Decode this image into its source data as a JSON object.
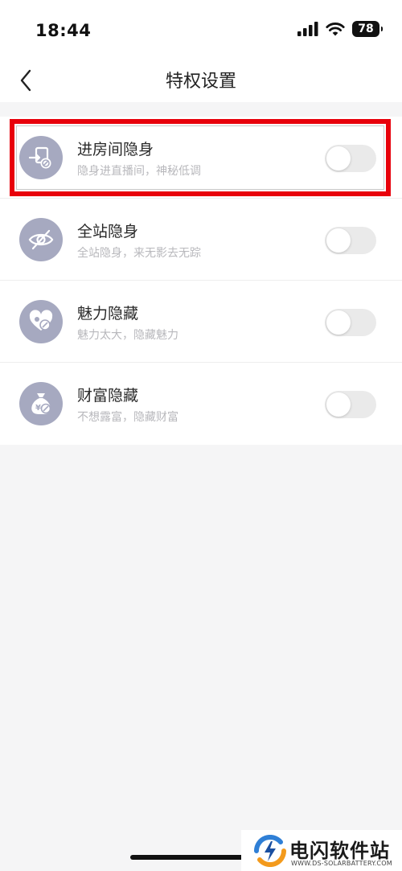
{
  "status_bar": {
    "time": "18:44",
    "battery": "78"
  },
  "header": {
    "title": "特权设置"
  },
  "settings": [
    {
      "title": "进房间隐身",
      "subtitle": "隐身进直播间，神秘低调",
      "icon": "enter-room-hidden-icon",
      "enabled": false
    },
    {
      "title": "全站隐身",
      "subtitle": "全站隐身，来无影去无踪",
      "icon": "eye-hidden-icon",
      "enabled": false
    },
    {
      "title": "魅力隐藏",
      "subtitle": "魅力太大，隐藏魅力",
      "icon": "heart-hidden-icon",
      "enabled": false
    },
    {
      "title": "财富隐藏",
      "subtitle": "不想露富，隐藏财富",
      "icon": "money-bag-hidden-icon",
      "enabled": false
    }
  ],
  "watermark": {
    "title": "电闪软件站",
    "url": "WWW.DS-SOLARBATTERY.COM"
  },
  "colors": {
    "icon_bg": "#a6a9c0",
    "highlight": "#e8000b",
    "toggle_off": "#eaeaea"
  }
}
